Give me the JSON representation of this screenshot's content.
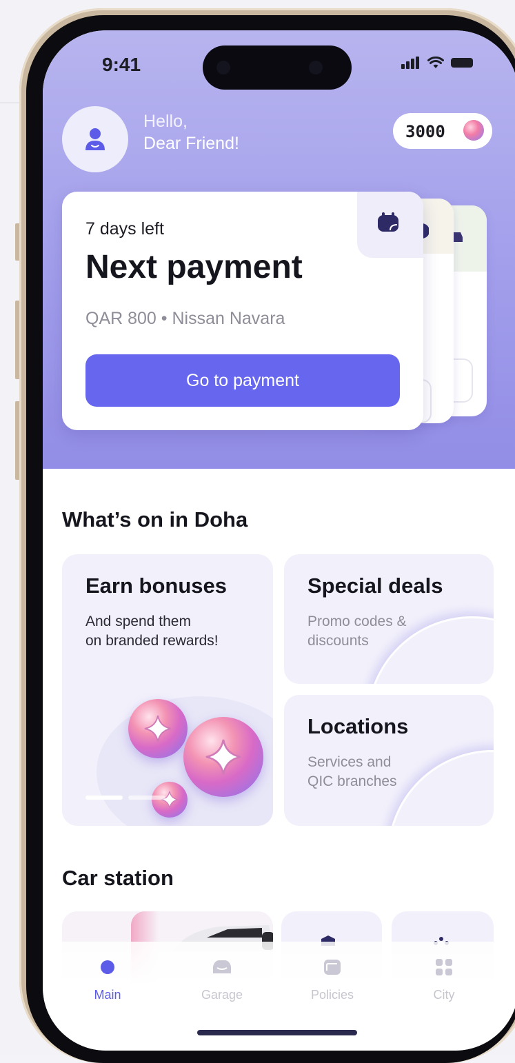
{
  "status_bar": {
    "time": "9:41"
  },
  "header": {
    "greeting_line1": "Hello,",
    "greeting_line2": "Dear Friend!",
    "points": "3000",
    "avatar_icon": "user-icon",
    "points_icon": "coin-icon"
  },
  "payment_card": {
    "days_left": "7 days left",
    "title": "Next payment",
    "subtitle": "QAR 800 • Nissan Navara",
    "button_label": "Go to payment",
    "tag_icon": "wallet-icon"
  },
  "whats_on": {
    "title": "What’s on in Doha",
    "tiles": [
      {
        "title": "Earn bonuses",
        "line1": "And spend them",
        "line2": "on branded rewards!"
      },
      {
        "title": "Special deals",
        "line1": "Promo codes &",
        "line2": "discounts"
      },
      {
        "title": "Locations",
        "line1": "Services and",
        "line2": "QIC branches"
      }
    ]
  },
  "car_station": {
    "title": "Car station"
  },
  "tabbar": {
    "items": [
      {
        "label": "Main",
        "icon": "home-dot-icon",
        "active": true
      },
      {
        "label": "Garage",
        "icon": "car-icon",
        "active": false
      },
      {
        "label": "Policies",
        "icon": "folder-icon",
        "active": false
      },
      {
        "label": "City",
        "icon": "grid-icon",
        "active": false
      }
    ]
  },
  "colors": {
    "accent": "#6766ee",
    "hero_top": "#b7b4ef",
    "hero_bottom": "#928de6",
    "tile_bg": "#f2f1fb",
    "active_tab": "#5d5ce8",
    "frame": "#c9b79f"
  }
}
